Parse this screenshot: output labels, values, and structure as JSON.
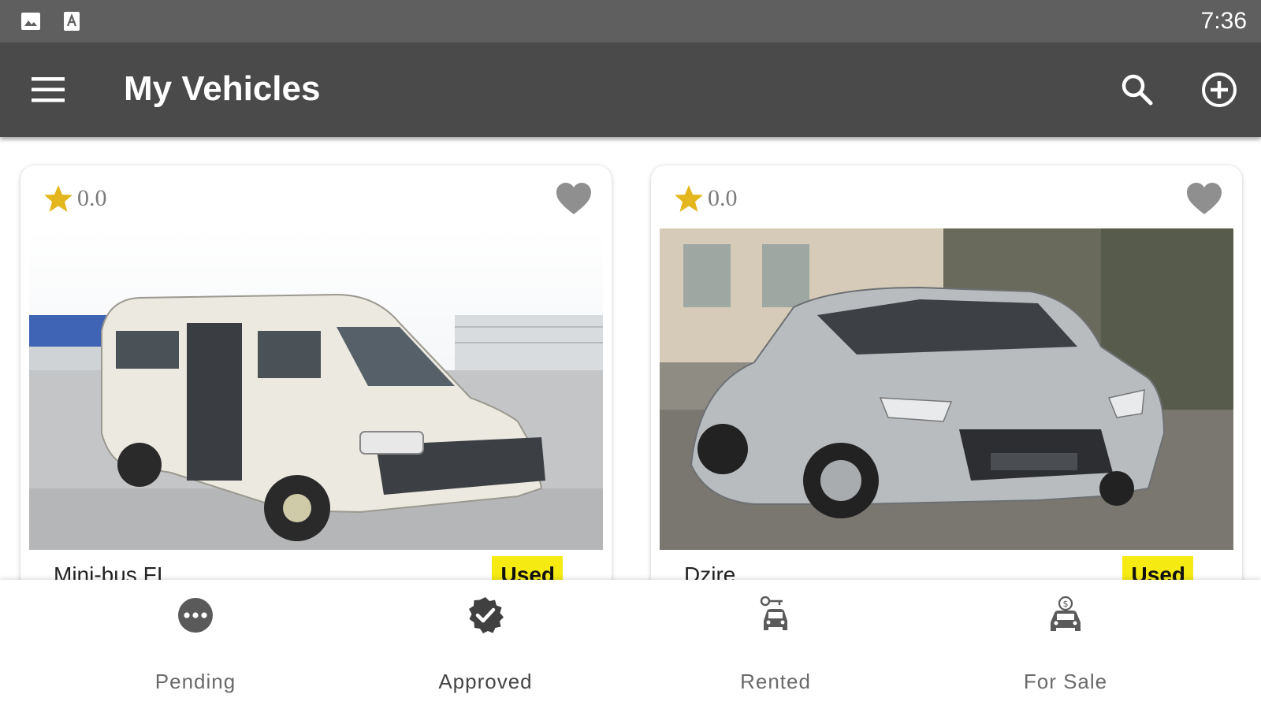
{
  "status_bar": {
    "time": "7:36",
    "icons": [
      "image-notification-icon",
      "text-notification-icon"
    ]
  },
  "app_bar": {
    "title": "My Vehicles",
    "icons": [
      "menu-icon",
      "search-icon",
      "add-circle-icon"
    ]
  },
  "vehicles": [
    {
      "rating": "0.0",
      "name": "Mini-bus FI",
      "badge": "Used",
      "image": "white-minibus-photo",
      "favorite_icon": "heart-icon"
    },
    {
      "rating": "0.0",
      "name": "Dzire",
      "badge": "Used",
      "image": "silver-sedan-photo",
      "favorite_icon": "heart-icon"
    }
  ],
  "bottom_nav": {
    "items": [
      {
        "label": "Pending",
        "icon": "pending-dots-icon"
      },
      {
        "label": "Approved",
        "icon": "approved-badge-icon",
        "active": true
      },
      {
        "label": "Rented",
        "icon": "rented-car-key-icon"
      },
      {
        "label": "For Sale",
        "icon": "for-sale-car-icon"
      }
    ]
  },
  "colors": {
    "status_bar": "#5f5f5f",
    "app_bar": "#4a4a4a",
    "star": "#e4b61d",
    "badge": "#f6ea13",
    "heart": "#8f8f8f"
  }
}
